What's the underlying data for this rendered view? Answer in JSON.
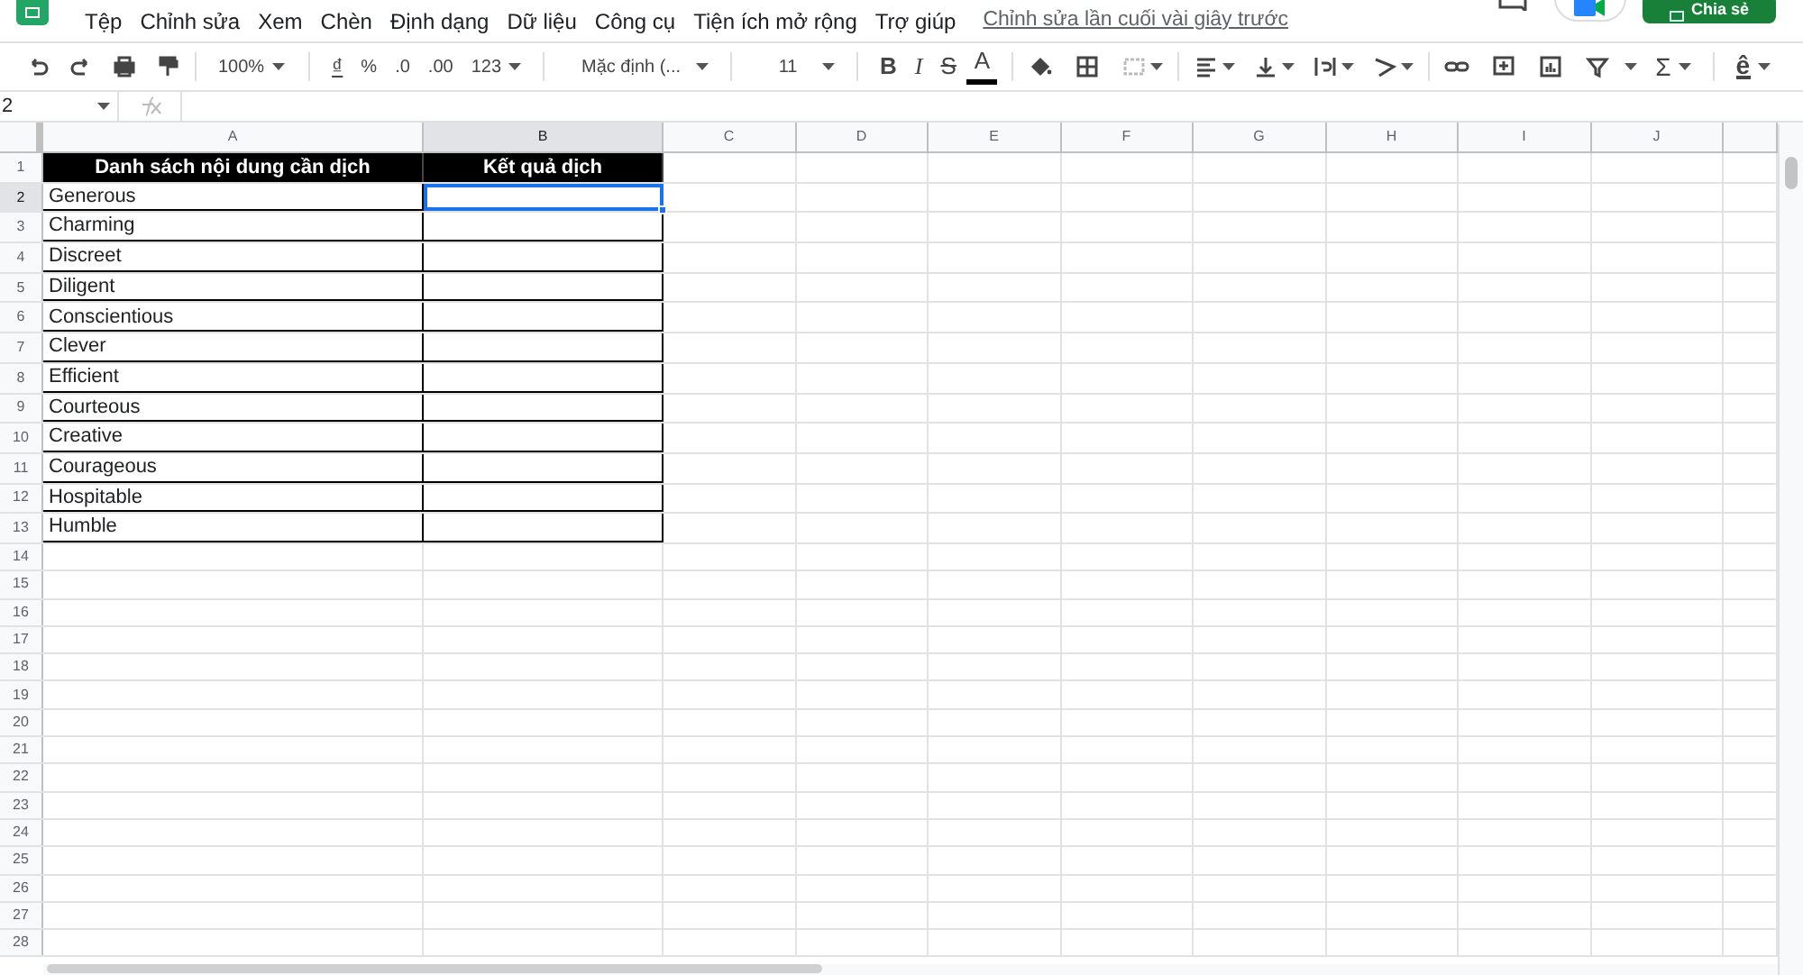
{
  "menu": [
    "Tệp",
    "Chỉnh sửa",
    "Xem",
    "Chèn",
    "Định dạng",
    "Dữ liệu",
    "Công cụ",
    "Tiện ích mở rộng",
    "Trợ giúp"
  ],
  "last_edit": "Chỉnh sửa lần cuối vài giây trước",
  "share_button": "Chia sẻ",
  "toolbar": {
    "zoom": "100%",
    "currency": "₫",
    "percent": "%",
    "decrease_decimal": ".0",
    "increase_decimal": ".00",
    "format": "123",
    "font": "Mặc định (...",
    "font_size": "11",
    "bold": "B",
    "italic": "I",
    "strikethrough": "S",
    "text_color": "A",
    "functions": "Σ",
    "input_tools": "ê"
  },
  "name_box": "2",
  "columns": [
    {
      "label": "A",
      "selected": false
    },
    {
      "label": "B",
      "selected": true
    },
    {
      "label": "C",
      "selected": false
    },
    {
      "label": "D",
      "selected": false
    },
    {
      "label": "E",
      "selected": false
    },
    {
      "label": "F",
      "selected": false
    },
    {
      "label": "G",
      "selected": false
    },
    {
      "label": "H",
      "selected": false
    },
    {
      "label": "I",
      "selected": false
    },
    {
      "label": "J",
      "selected": false
    }
  ],
  "rows": [
    {
      "number": "1",
      "kind": "header",
      "selected": false,
      "cells": [
        {
          "text": "Danh sách nội dung cần dịch",
          "selected": false
        },
        {
          "text": "Kết quả dịch",
          "selected": false
        }
      ]
    },
    {
      "number": "2",
      "kind": "data",
      "selected": true,
      "cells": [
        {
          "text": "Generous",
          "selected": false
        },
        {
          "selected": true
        }
      ]
    },
    {
      "number": "3",
      "kind": "data",
      "selected": false,
      "cells": [
        {
          "text": "Charming",
          "selected": false
        },
        {
          "selected": false
        }
      ]
    },
    {
      "number": "4",
      "kind": "data",
      "selected": false,
      "cells": [
        {
          "text": "Discreet",
          "selected": false
        },
        {
          "selected": false
        }
      ]
    },
    {
      "number": "5",
      "kind": "data",
      "selected": false,
      "cells": [
        {
          "text": "Diligent",
          "selected": false
        },
        {
          "selected": false
        }
      ]
    },
    {
      "number": "6",
      "kind": "data",
      "selected": false,
      "cells": [
        {
          "text": "Conscientious",
          "selected": false
        },
        {
          "selected": false
        }
      ]
    },
    {
      "number": "7",
      "kind": "data",
      "selected": false,
      "cells": [
        {
          "text": "Clever",
          "selected": false
        },
        {
          "selected": false
        }
      ]
    },
    {
      "number": "8",
      "kind": "data",
      "selected": false,
      "cells": [
        {
          "text": "Efficient",
          "selected": false
        },
        {
          "selected": false
        }
      ]
    },
    {
      "number": "9",
      "kind": "data",
      "selected": false,
      "cells": [
        {
          "text": "Courteous",
          "selected": false
        },
        {
          "selected": false
        }
      ]
    },
    {
      "number": "10",
      "kind": "data",
      "selected": false,
      "cells": [
        {
          "text": "Creative",
          "selected": false
        },
        {
          "selected": false
        }
      ]
    },
    {
      "number": "11",
      "kind": "data",
      "selected": false,
      "cells": [
        {
          "text": "Courageous",
          "selected": false
        },
        {
          "selected": false
        }
      ]
    },
    {
      "number": "12",
      "kind": "data",
      "selected": false,
      "cells": [
        {
          "text": "Hospitable",
          "selected": false
        },
        {
          "selected": false
        }
      ]
    },
    {
      "number": "13",
      "kind": "data",
      "selected": false,
      "cells": [
        {
          "text": "Humble",
          "selected": false
        },
        {
          "selected": false
        }
      ]
    },
    {
      "number": "14",
      "kind": "empty",
      "selected": false
    },
    {
      "number": "15",
      "kind": "empty",
      "selected": false
    },
    {
      "number": "16",
      "kind": "empty",
      "selected": false
    },
    {
      "number": "17",
      "kind": "empty",
      "selected": false
    },
    {
      "number": "18",
      "kind": "empty",
      "selected": false
    },
    {
      "number": "19",
      "kind": "empty",
      "selected": false
    },
    {
      "number": "20",
      "kind": "empty",
      "selected": false
    },
    {
      "number": "21",
      "kind": "empty",
      "selected": false
    },
    {
      "number": "22",
      "kind": "empty",
      "selected": false
    },
    {
      "number": "23",
      "kind": "empty",
      "selected": false
    },
    {
      "number": "24",
      "kind": "empty",
      "selected": false
    },
    {
      "number": "25",
      "kind": "empty",
      "selected": false
    },
    {
      "number": "26",
      "kind": "empty",
      "selected": false
    },
    {
      "number": "27",
      "kind": "empty",
      "selected": false
    },
    {
      "number": "28",
      "kind": "empty",
      "selected": false
    }
  ]
}
